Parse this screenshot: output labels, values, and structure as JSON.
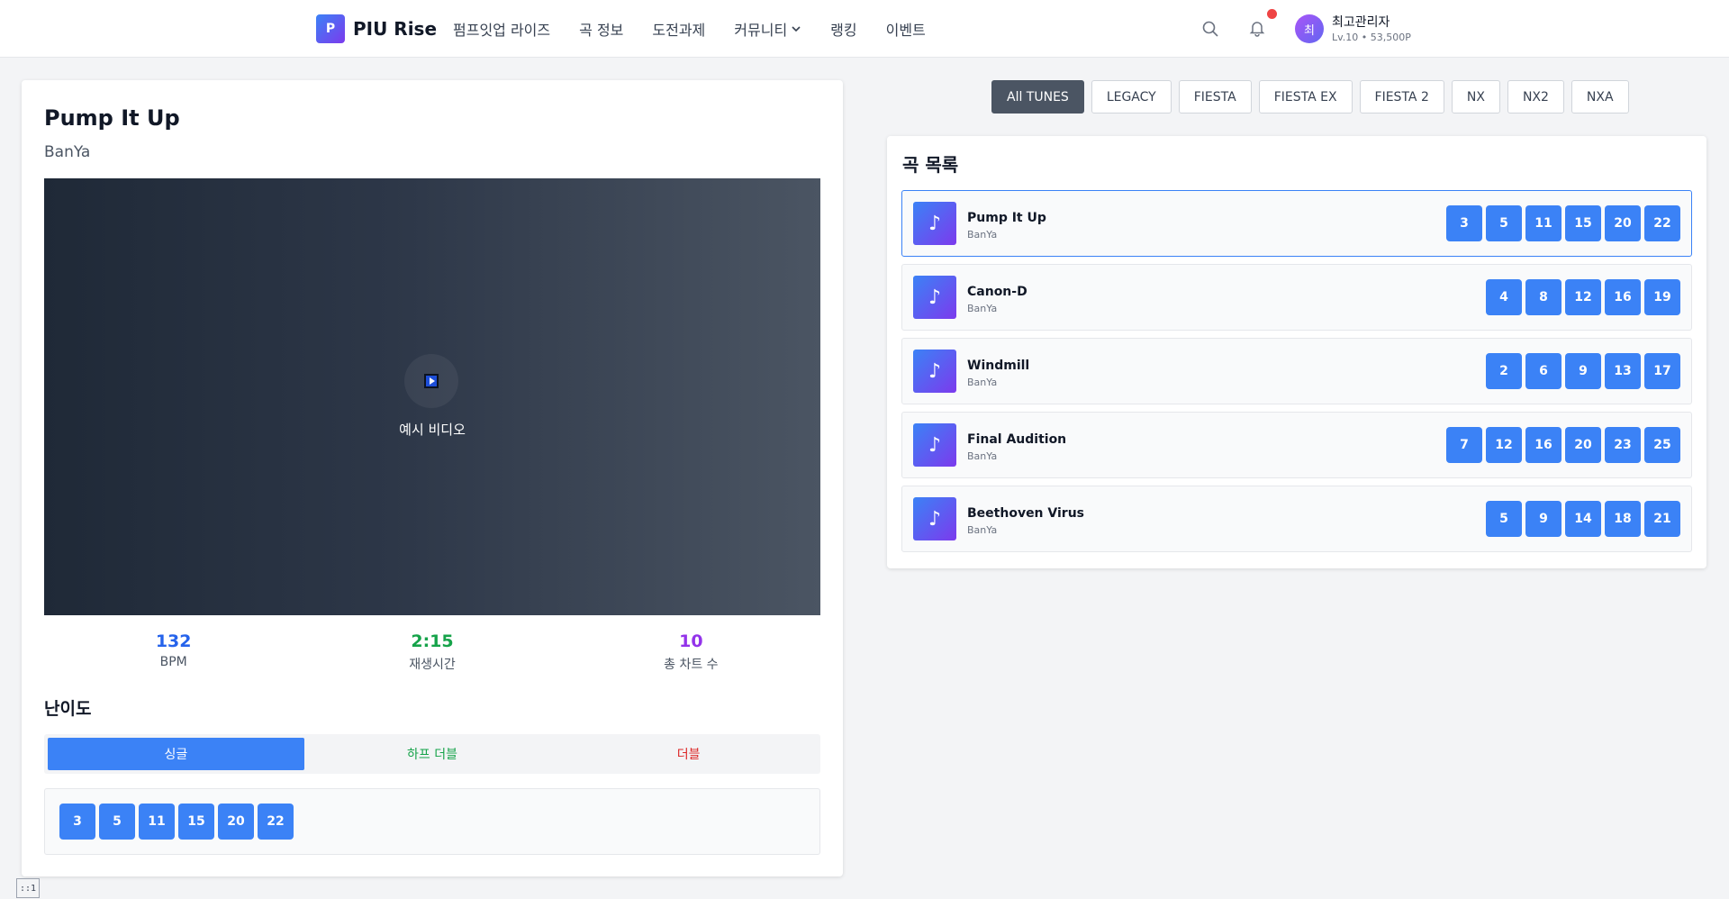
{
  "header": {
    "logo_letter": "P",
    "logo_text": "PIU Rise",
    "nav": [
      "펌프잇업 라이즈",
      "곡 정보",
      "도전과제",
      "커뮤니티",
      "랭킹",
      "이벤트"
    ],
    "user": {
      "avatar_initial": "최",
      "name": "최고관리자",
      "sub": "Lv.10 • 53,500P"
    }
  },
  "detail": {
    "title": "Pump It Up",
    "artist": "BanYa",
    "video_label": "예시 비디오",
    "stats": [
      {
        "value": "132",
        "label": "BPM",
        "color": "#2563eb"
      },
      {
        "value": "2:15",
        "label": "재생시간",
        "color": "#16a34a"
      },
      {
        "value": "10",
        "label": "총 차트 수",
        "color": "#9333ea"
      }
    ],
    "difficulty_heading": "난이도",
    "tabs": [
      {
        "label": "싱글",
        "color": "#ffffff",
        "active": true
      },
      {
        "label": "하프 더블",
        "color": "#16a34a",
        "active": false
      },
      {
        "label": "더블",
        "color": "#dc2626",
        "active": false
      }
    ],
    "levels": [
      "3",
      "5",
      "11",
      "15",
      "20",
      "22"
    ]
  },
  "versions": [
    "All TUNES",
    "LEGACY",
    "FIESTA",
    "FIESTA EX",
    "FIESTA 2",
    "NX",
    "NX2",
    "NXA"
  ],
  "song_list": {
    "title": "곡 목록",
    "songs": [
      {
        "title": "Pump It Up",
        "artist": "BanYa",
        "levels": [
          "3",
          "5",
          "11",
          "15",
          "20",
          "22"
        ],
        "selected": true
      },
      {
        "title": "Canon-D",
        "artist": "BanYa",
        "levels": [
          "4",
          "8",
          "12",
          "16",
          "19"
        ]
      },
      {
        "title": "Windmill",
        "artist": "BanYa",
        "levels": [
          "2",
          "6",
          "9",
          "13",
          "17"
        ]
      },
      {
        "title": "Final Audition",
        "artist": "BanYa",
        "levels": [
          "7",
          "12",
          "16",
          "20",
          "23",
          "25"
        ]
      },
      {
        "title": "Beethoven Virus",
        "artist": "BanYa",
        "levels": [
          "5",
          "9",
          "14",
          "18",
          "21"
        ]
      }
    ]
  },
  "corner_badge": "::1",
  "colors": {
    "accent": "#3b82f6",
    "brand_gradient_start": "#3b82f6",
    "brand_gradient_end": "#7c3aed"
  }
}
